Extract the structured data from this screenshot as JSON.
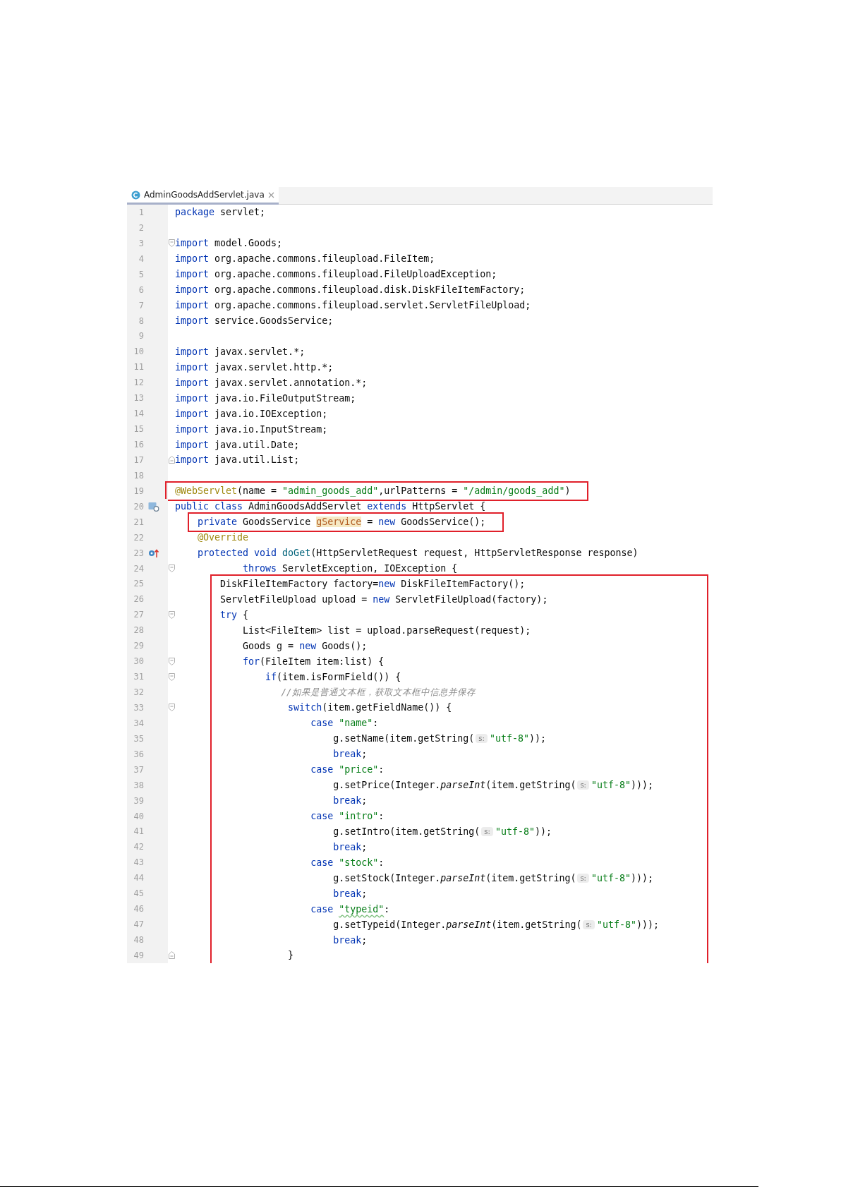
{
  "tab": {
    "title": "AdminGoodsAddServlet.java",
    "selected": true
  },
  "lines": [
    {
      "number": "1",
      "segments": [
        {
          "kind": "kw",
          "text": "package"
        },
        {
          "kind": "plain",
          "text": " servlet;"
        }
      ]
    },
    {
      "number": "2"
    },
    {
      "number": "3",
      "fold": {
        "kind": "start"
      },
      "segments": [
        {
          "kind": "kw",
          "text": "import"
        },
        {
          "kind": "plain",
          "text": " model.Goods;"
        }
      ]
    },
    {
      "number": "4",
      "segments": [
        {
          "kind": "kw",
          "text": "import"
        },
        {
          "kind": "plain",
          "text": " org.apache.commons.fileupload.FileItem;"
        }
      ]
    },
    {
      "number": "5",
      "segments": [
        {
          "kind": "kw",
          "text": "import"
        },
        {
          "kind": "plain",
          "text": " org.apache.commons.fileupload.FileUploadException;"
        }
      ]
    },
    {
      "number": "6",
      "segments": [
        {
          "kind": "kw",
          "text": "import"
        },
        {
          "kind": "plain",
          "text": " org.apache.commons.fileupload.disk.DiskFileItemFactory;"
        }
      ]
    },
    {
      "number": "7",
      "segments": [
        {
          "kind": "kw",
          "text": "import"
        },
        {
          "kind": "plain",
          "text": " org.apache.commons.fileupload.servlet.ServletFileUpload;"
        }
      ]
    },
    {
      "number": "8",
      "segments": [
        {
          "kind": "kw",
          "text": "import"
        },
        {
          "kind": "plain",
          "text": " service.GoodsService;"
        }
      ]
    },
    {
      "number": "9"
    },
    {
      "number": "10",
      "segments": [
        {
          "kind": "kw",
          "text": "import"
        },
        {
          "kind": "plain",
          "text": " javax.servlet.*;"
        }
      ]
    },
    {
      "number": "11",
      "segments": [
        {
          "kind": "kw",
          "text": "import"
        },
        {
          "kind": "plain",
          "text": " javax.servlet.http.*;"
        }
      ]
    },
    {
      "number": "12",
      "segments": [
        {
          "kind": "kw",
          "text": "import"
        },
        {
          "kind": "plain",
          "text": " javax.servlet.annotation.*;"
        }
      ]
    },
    {
      "number": "13",
      "segments": [
        {
          "kind": "kw",
          "text": "import"
        },
        {
          "kind": "plain",
          "text": " java.io.FileOutputStream;"
        }
      ]
    },
    {
      "number": "14",
      "segments": [
        {
          "kind": "kw",
          "text": "import"
        },
        {
          "kind": "plain",
          "text": " java.io.IOException;"
        }
      ]
    },
    {
      "number": "15",
      "segments": [
        {
          "kind": "kw",
          "text": "import"
        },
        {
          "kind": "plain",
          "text": " java.io.InputStream;"
        }
      ]
    },
    {
      "number": "16",
      "segments": [
        {
          "kind": "kw",
          "text": "import"
        },
        {
          "kind": "plain",
          "text": " java.util.Date;"
        }
      ]
    },
    {
      "number": "17",
      "fold": {
        "kind": "end"
      },
      "segments": [
        {
          "kind": "kw",
          "text": "import"
        },
        {
          "kind": "plain",
          "text": " java.util.List;"
        }
      ]
    },
    {
      "number": "18"
    },
    {
      "number": "19",
      "boxed": true,
      "segments": [
        {
          "kind": "ann",
          "text": "@WebServlet"
        },
        {
          "kind": "plain",
          "text": "(name = "
        },
        {
          "kind": "str",
          "text": "\"admin_goods_add\""
        },
        {
          "kind": "plain",
          "text": ",urlPatterns = "
        },
        {
          "kind": "str",
          "text": "\"/admin/goods_add\""
        },
        {
          "kind": "plain",
          "text": ")"
        }
      ]
    },
    {
      "number": "20",
      "gutter": {
        "kind": "class"
      },
      "segments": [
        {
          "kind": "kw",
          "text": "public class"
        },
        {
          "kind": "plain",
          "text": " AdminGoodsAddServlet "
        },
        {
          "kind": "kw",
          "text": "extends"
        },
        {
          "kind": "plain",
          "text": " HttpServlet {"
        }
      ]
    },
    {
      "number": "21",
      "boxed": true,
      "segments": [
        {
          "kind": "kw",
          "text": "    private"
        },
        {
          "kind": "plain",
          "text": " GoodsService "
        },
        {
          "kind": "mark",
          "text": "gService"
        },
        {
          "kind": "plain",
          "text": " = "
        },
        {
          "kind": "kw",
          "text": "new"
        },
        {
          "kind": "plain",
          "text": " GoodsService();"
        }
      ]
    },
    {
      "number": "22",
      "segments": [
        {
          "kind": "ann",
          "text": "    @Override"
        }
      ]
    },
    {
      "number": "23",
      "gutter": {
        "kind": "override"
      },
      "segments": [
        {
          "kind": "kw",
          "text": "    protected void "
        },
        {
          "kind": "decl",
          "text": "doGet"
        },
        {
          "kind": "plain",
          "text": "(HttpServletRequest request, HttpServletResponse response)"
        }
      ]
    },
    {
      "number": "24",
      "fold": {
        "kind": "start"
      },
      "segments": [
        {
          "kind": "kw",
          "text": "            throws"
        },
        {
          "kind": "plain",
          "text": " ServletException, IOException {"
        }
      ]
    },
    {
      "number": "25",
      "boxed": true,
      "segments": [
        {
          "kind": "plain",
          "text": "        DiskFileItemFactory factory="
        },
        {
          "kind": "kw",
          "text": "new"
        },
        {
          "kind": "plain",
          "text": " DiskFileItemFactory();"
        }
      ]
    },
    {
      "number": "26",
      "boxed": true,
      "segments": [
        {
          "kind": "plain",
          "text": "        ServletFileUpload upload = "
        },
        {
          "kind": "kw",
          "text": "new"
        },
        {
          "kind": "plain",
          "text": " ServletFileUpload(factory);"
        }
      ]
    },
    {
      "number": "27",
      "boxed": true,
      "fold": {
        "kind": "start"
      },
      "segments": [
        {
          "kind": "kw",
          "text": "        try"
        },
        {
          "kind": "plain",
          "text": " {"
        }
      ]
    },
    {
      "number": "28",
      "boxed": true,
      "segments": [
        {
          "kind": "plain",
          "text": "            List<FileItem> list = upload.parseRequest(request);"
        }
      ]
    },
    {
      "number": "29",
      "boxed": true,
      "segments": [
        {
          "kind": "plain",
          "text": "            Goods g = "
        },
        {
          "kind": "kw",
          "text": "new"
        },
        {
          "kind": "plain",
          "text": " Goods();"
        }
      ]
    },
    {
      "number": "30",
      "boxed": true,
      "fold": {
        "kind": "start"
      },
      "segments": [
        {
          "kind": "kw",
          "text": "            for"
        },
        {
          "kind": "plain",
          "text": "(FileItem item:list) {"
        }
      ]
    },
    {
      "number": "31",
      "boxed": true,
      "fold": {
        "kind": "start"
      },
      "segments": [
        {
          "kind": "kw",
          "text": "                if"
        },
        {
          "kind": "plain",
          "text": "(item.isFormField()) {"
        }
      ]
    },
    {
      "number": "32",
      "boxed": true,
      "segments": [
        {
          "kind": "cmt",
          "text": "                    //如果是普通文本框，获取文本框中信息并保存"
        }
      ]
    },
    {
      "number": "33",
      "boxed": true,
      "fold": {
        "kind": "start"
      },
      "segments": [
        {
          "kind": "kw",
          "text": "                    switch"
        },
        {
          "kind": "plain",
          "text": "(item.getFieldName()) {"
        }
      ]
    },
    {
      "number": "34",
      "boxed": true,
      "segments": [
        {
          "kind": "kw",
          "text": "                        case "
        },
        {
          "kind": "str",
          "text": "\"name\""
        },
        {
          "kind": "plain",
          "text": ":"
        }
      ]
    },
    {
      "number": "35",
      "boxed": true,
      "segments": [
        {
          "kind": "plain",
          "text": "                            g.setName(item.getString("
        },
        {
          "kind": "hint",
          "text": "s:"
        },
        {
          "kind": "str",
          "text": "\"utf-8\""
        },
        {
          "kind": "plain",
          "text": "));"
        }
      ]
    },
    {
      "number": "36",
      "boxed": true,
      "segments": [
        {
          "kind": "kw",
          "text": "                            break"
        },
        {
          "kind": "plain",
          "text": ";"
        }
      ]
    },
    {
      "number": "37",
      "boxed": true,
      "segments": [
        {
          "kind": "kw",
          "text": "                        case "
        },
        {
          "kind": "str",
          "text": "\"price\""
        },
        {
          "kind": "plain",
          "text": ":"
        }
      ]
    },
    {
      "number": "38",
      "boxed": true,
      "segments": [
        {
          "kind": "plain",
          "text": "                            g.setPrice(Integer."
        },
        {
          "kind": "ital",
          "text": "parseInt"
        },
        {
          "kind": "plain",
          "text": "(item.getString("
        },
        {
          "kind": "hint",
          "text": "s:"
        },
        {
          "kind": "str",
          "text": "\"utf-8\""
        },
        {
          "kind": "plain",
          "text": ")));"
        }
      ]
    },
    {
      "number": "39",
      "boxed": true,
      "segments": [
        {
          "kind": "kw",
          "text": "                            break"
        },
        {
          "kind": "plain",
          "text": ";"
        }
      ]
    },
    {
      "number": "40",
      "boxed": true,
      "segments": [
        {
          "kind": "kw",
          "text": "                        case "
        },
        {
          "kind": "str",
          "text": "\"intro\""
        },
        {
          "kind": "plain",
          "text": ":"
        }
      ]
    },
    {
      "number": "41",
      "boxed": true,
      "segments": [
        {
          "kind": "plain",
          "text": "                            g.setIntro(item.getString("
        },
        {
          "kind": "hint",
          "text": "s:"
        },
        {
          "kind": "str",
          "text": "\"utf-8\""
        },
        {
          "kind": "plain",
          "text": "));"
        }
      ]
    },
    {
      "number": "42",
      "boxed": true,
      "segments": [
        {
          "kind": "kw",
          "text": "                            break"
        },
        {
          "kind": "plain",
          "text": ";"
        }
      ]
    },
    {
      "number": "43",
      "boxed": true,
      "segments": [
        {
          "kind": "kw",
          "text": "                        case "
        },
        {
          "kind": "str",
          "text": "\"stock\""
        },
        {
          "kind": "plain",
          "text": ":"
        }
      ]
    },
    {
      "number": "44",
      "boxed": true,
      "segments": [
        {
          "kind": "plain",
          "text": "                            g.setStock(Integer."
        },
        {
          "kind": "ital",
          "text": "parseInt"
        },
        {
          "kind": "plain",
          "text": "(item.getString("
        },
        {
          "kind": "hint",
          "text": "s:"
        },
        {
          "kind": "str",
          "text": "\"utf-8\""
        },
        {
          "kind": "plain",
          "text": ")));"
        }
      ]
    },
    {
      "number": "45",
      "boxed": true,
      "segments": [
        {
          "kind": "kw",
          "text": "                            break"
        },
        {
          "kind": "plain",
          "text": ";"
        }
      ]
    },
    {
      "number": "46",
      "boxed": true,
      "segments": [
        {
          "kind": "kw",
          "text": "                        case "
        },
        {
          "kind": "typo",
          "text": "\"typeid\""
        },
        {
          "kind": "plain",
          "text": ":"
        }
      ]
    },
    {
      "number": "47",
      "boxed": true,
      "segments": [
        {
          "kind": "plain",
          "text": "                            g.setTypeid(Integer."
        },
        {
          "kind": "ital",
          "text": "parseInt"
        },
        {
          "kind": "plain",
          "text": "(item.getString("
        },
        {
          "kind": "hint",
          "text": "s:"
        },
        {
          "kind": "str",
          "text": "\"utf-8\""
        },
        {
          "kind": "plain",
          "text": ")));"
        }
      ]
    },
    {
      "number": "48",
      "boxed": true,
      "segments": [
        {
          "kind": "kw",
          "text": "                            break"
        },
        {
          "kind": "plain",
          "text": ";"
        }
      ]
    },
    {
      "number": "49",
      "boxed": true,
      "fold": {
        "kind": "end"
      },
      "segments": [
        {
          "kind": "plain",
          "text": "                    }"
        }
      ]
    }
  ]
}
